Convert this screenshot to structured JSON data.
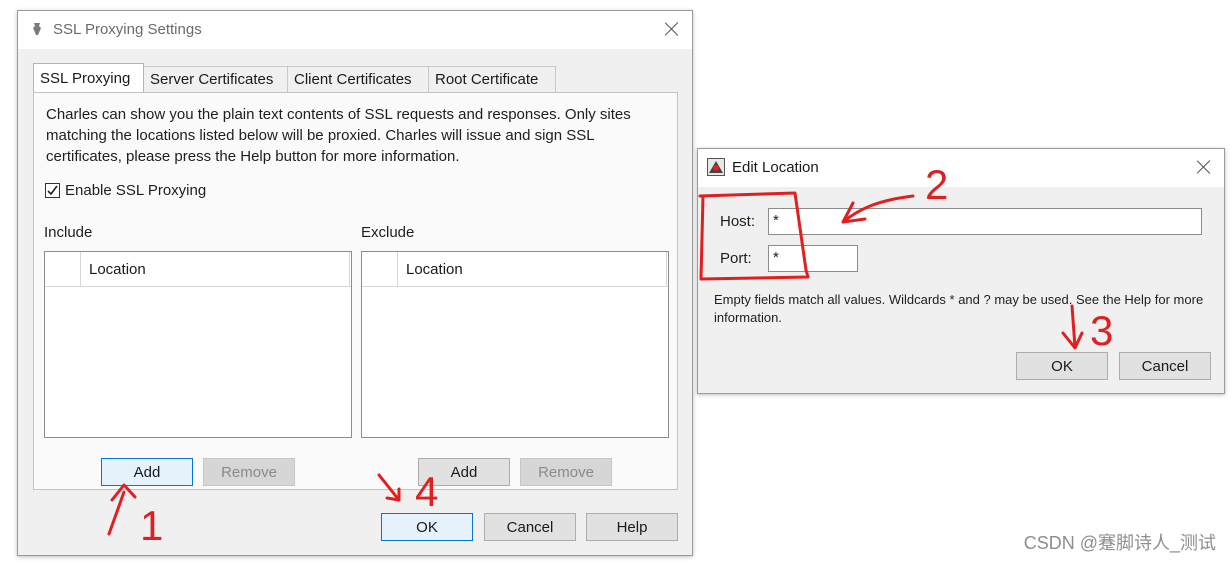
{
  "ssl_dialog": {
    "title": "SSL Proxying Settings",
    "tabs": [
      "SSL Proxying",
      "Server Certificates",
      "Client Certificates",
      "Root Certificate"
    ],
    "description": "Charles can show you the plain text contents of SSL requests and responses. Only sites matching the locations listed below will be proxied. Charles will issue and sign SSL certificates, please press the Help button for more information.",
    "enable_label": "Enable SSL Proxying",
    "enable_checked": true,
    "include": {
      "label": "Include",
      "column": "Location",
      "add": "Add",
      "remove": "Remove"
    },
    "exclude": {
      "label": "Exclude",
      "column": "Location",
      "add": "Add",
      "remove": "Remove"
    },
    "ok": "OK",
    "cancel": "Cancel",
    "help": "Help"
  },
  "edit_location": {
    "title": "Edit Location",
    "host_label": "Host:",
    "host_value": "*",
    "port_label": "Port:",
    "port_value": "*",
    "hint": "Empty fields match all values. Wildcards * and ? may be used. See the Help for more information.",
    "ok": "OK",
    "cancel": "Cancel"
  },
  "annotations": {
    "n1": "1",
    "n2": "2",
    "n3": "3",
    "n4": "4",
    "color": "#e02020"
  },
  "watermark": "CSDN @蹇脚诗人_测试"
}
